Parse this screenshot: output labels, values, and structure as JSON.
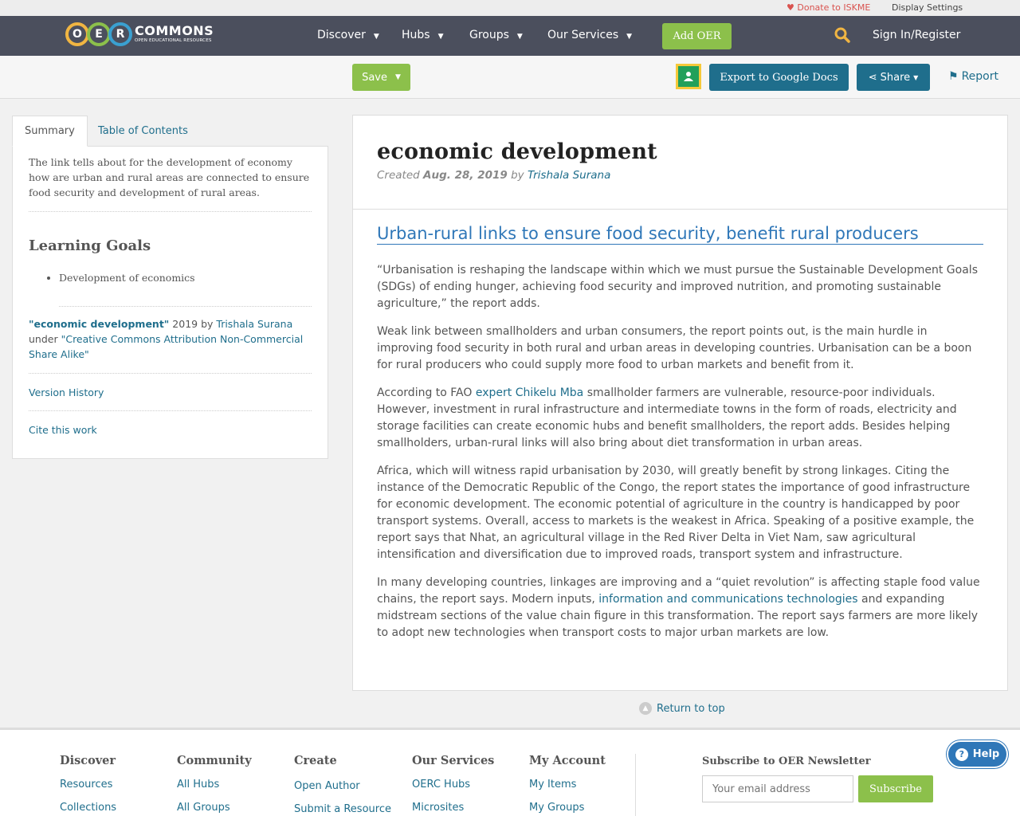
{
  "topbar": {
    "donate": "Donate to ISKME",
    "display_settings": "Display Settings"
  },
  "nav": {
    "logo_text": "COMMONS",
    "logo_subtext": "OPEN EDUCATIONAL RESOURCES",
    "logo_letters": [
      "O",
      "E",
      "R"
    ],
    "items": [
      {
        "label": "Discover"
      },
      {
        "label": "Hubs"
      },
      {
        "label": "Groups"
      },
      {
        "label": "Our Services"
      }
    ],
    "add_oer": "Add OER",
    "sign_in": "Sign In/Register"
  },
  "toolbar": {
    "save": "Save",
    "export": "Export to Google Docs",
    "share": "Share",
    "report": "Report"
  },
  "sidebar": {
    "tabs": [
      "Summary",
      "Table of Contents"
    ],
    "summary": "The link tells about for the development of economy how are urban and rural areas are connected to ensure food security and development of rural areas.",
    "learning_goals_title": "Learning Goals",
    "learning_goals": [
      "Development of economics"
    ],
    "license": {
      "title": "\"economic development\"",
      "year_by": " 2019 by ",
      "author": "Trishala Surana",
      "under": "under ",
      "license_name": "\"Creative Commons Attribution Non-Commercial Share Alike\""
    },
    "version_history": "Version History",
    "cite": "Cite this work"
  },
  "main": {
    "title": "economic development",
    "created_label": "Created",
    "created_date": "Aug. 28, 2019",
    "by_label": "by",
    "author": "Trishala Surana",
    "article_title": "Urban-rural links to ensure food security, benefit rural producers",
    "p1": "“Urbanisation is reshaping the landscape within which we must pursue the Sustainable Development Goals (SDGs) of ending hunger, achieving food security and improved nutrition, and promoting sustainable agriculture,” the report adds.",
    "p2": "Weak link between smallholders and urban consumers, the report points out, is the main hurdle in improving food security in both rural and urban areas in developing countries. Urbanisation can be a boon for rural producers who could supply more food to urban markets and benefit from it.",
    "p3_before": "According to FAO ",
    "p3_link": "expert Chikelu Mba",
    "p3_after": " smallholder farmers are vulnerable, resource-poor individuals. However, investment in rural infrastructure and intermediate towns in the form of roads, electricity and storage facilities can create economic hubs and benefit smallholders, the report adds. Besides helping smallholders, urban-rural links will also bring about diet transformation in urban areas.",
    "p4": "Africa, which will witness rapid urbanisation by 2030, will greatly benefit by strong linkages. Citing the instance of the Democratic Republic of the Congo, the report states the importance of good infrastructure for economic development. The economic potential of agriculture in the country is handicapped by poor transport systems. Overall, access to markets is the weakest in Africa. Speaking of a positive example, the report says that Nhat, an agricultural village in the Red River Delta in Viet Nam, saw agricultural intensification and diversification due to improved roads, transport system and infrastructure.",
    "p5_before": "In many developing countries, linkages are improving and a “quiet revolution” is affecting staple food value chains, the report says. Modern inputs, ",
    "p5_link": "information and communications technologies",
    "p5_after": " and expanding midstream sections of the value chain figure in this transformation. The report says farmers are more likely to adopt new technologies when transport costs to major urban markets are low."
  },
  "return_top": "Return to top",
  "footer": {
    "columns": [
      {
        "title": "Discover",
        "links": [
          "Resources",
          "Collections"
        ]
      },
      {
        "title": "Community",
        "links": [
          "All Hubs",
          "All Groups"
        ]
      },
      {
        "title": "Create",
        "links": [
          "Open Author",
          "Submit a Resource"
        ]
      },
      {
        "title": "Our Services",
        "links": [
          "OERC Hubs",
          "Microsites"
        ]
      },
      {
        "title": "My Account",
        "links": [
          "My Items",
          "My Groups"
        ]
      }
    ],
    "newsletter_title": "Subscribe to OER Newsletter",
    "email_placeholder": "Your email address",
    "subscribe": "Subscribe"
  },
  "help": "Help",
  "colors": {
    "nav_bg": "#4b4f5d",
    "accent_green": "#8cc04b",
    "accent_blue": "#1f6e8c",
    "link_blue": "#2f77b8",
    "donate_red": "#d9534f"
  }
}
